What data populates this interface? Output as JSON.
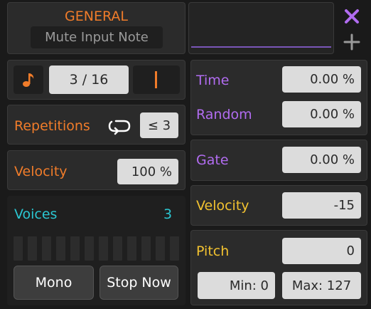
{
  "general": {
    "title": "GENERAL",
    "mute_input_note_label": "Mute Input Note"
  },
  "preview": {
    "close_icon": "close-icon",
    "add_icon": "plus-icon"
  },
  "rate": {
    "note_icon": "music-note-icon",
    "value": "3 / 16"
  },
  "repetitions": {
    "label": "Repetitions",
    "loop_icon": "loop-icon",
    "value": "≤ 3"
  },
  "left_velocity": {
    "label": "Velocity",
    "value": "100 %"
  },
  "voices": {
    "label": "Voices",
    "count": "3",
    "mono_label": "Mono",
    "stop_label": "Stop Now"
  },
  "time": {
    "label": "Time",
    "value": "0.00 %"
  },
  "random": {
    "label": "Random",
    "value": "0.00 %"
  },
  "gate": {
    "label": "Gate",
    "value": "0.00 %"
  },
  "right_velocity": {
    "label": "Velocity",
    "value": "-15"
  },
  "pitch": {
    "label": "Pitch",
    "value": "0",
    "min_label": "Min: 0",
    "max_label": "Max: 127"
  },
  "colors": {
    "orange": "#f07c2a",
    "purple": "#b16cf0",
    "yellow": "#f2c230",
    "cyan": "#2bc7d2"
  }
}
